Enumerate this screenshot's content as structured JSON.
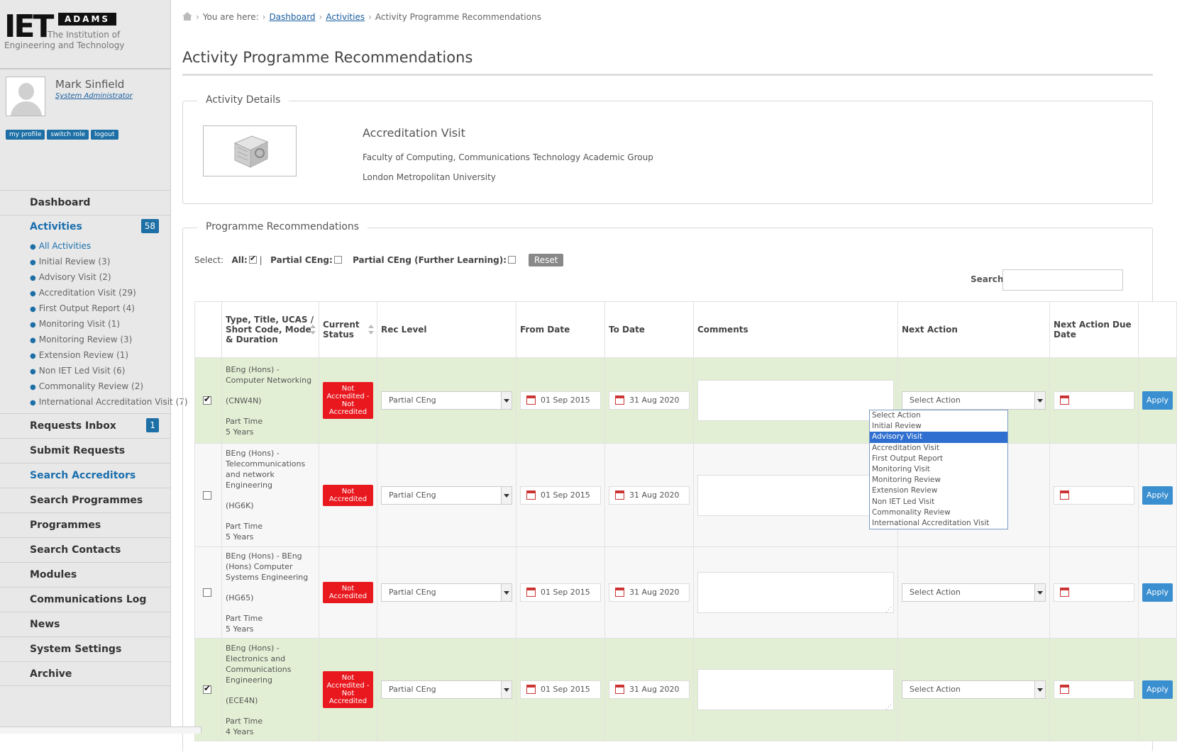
{
  "brand": {
    "logo_text": "IET",
    "product": "ADAMS",
    "institution_line1": "The Institution of",
    "institution_line2": "Engineering and Technology"
  },
  "user": {
    "name": "Mark Sinfield",
    "role": "System Administrator",
    "buttons": [
      "my profile",
      "switch role",
      "logout"
    ]
  },
  "nav": {
    "dashboard": "Dashboard",
    "activities": "Activities",
    "activities_count": "58",
    "activity_types": [
      "All Activities",
      "Initial Review (3)",
      "Advisory Visit (2)",
      "Accreditation Visit (29)",
      "First Output Report (4)",
      "Monitoring Visit (1)",
      "Monitoring Review (3)",
      "Extension Review (1)",
      "Non IET Led Visit (6)",
      "Commonality Review (2)",
      "International Accreditation Visit (7)"
    ],
    "requests_inbox": "Requests Inbox",
    "requests_inbox_count": "1",
    "items": [
      "Submit Requests",
      "Search Accreditors",
      "Search Programmes",
      "Programmes",
      "Search Contacts",
      "Modules",
      "Communications Log",
      "News",
      "System Settings",
      "Archive"
    ]
  },
  "breadcrumb": {
    "prefix": "You are here:",
    "dashboard": "Dashboard",
    "activities": "Activities",
    "current": "Activity Programme Recommendations"
  },
  "page_title": "Activity Programme Recommendations",
  "activity_details": {
    "legend": "Activity Details",
    "title": "Accreditation Visit",
    "faculty": "Faculty of Computing, Communications Technology Academic Group",
    "university": "London Metropolitan University"
  },
  "programme_recs": {
    "legend": "Programme Recommendations",
    "select_label": "Select:",
    "all_label": "All:",
    "partial_label": "Partial CEng:",
    "partial_fl_label": "Partial CEng (Further Learning):",
    "reset": "Reset",
    "search_label": "Search:",
    "search_value": "",
    "columns": {
      "type": "Type, Title, UCAS / Short Code, Mode & Duration",
      "status": "Current Status",
      "rec_level": "Rec Level",
      "from_date": "From Date",
      "to_date": "To Date",
      "comments": "Comments",
      "next_action": "Next Action",
      "due_date": "Next Action Due Date"
    },
    "rows": [
      {
        "checked": true,
        "title": "BEng (Hons) - Computer Networking",
        "code": "(CNW4N)",
        "mode": "Part Time",
        "duration": "5 Years",
        "status": "Not Accredited - Not Accredited",
        "rec_level": "Partial CEng",
        "from": "01 Sep 2015",
        "to": "31 Aug 2020",
        "next_action": "Select Action",
        "apply": "Apply"
      },
      {
        "checked": false,
        "title": "BEng (Hons) - Telecommunications and network Engineering",
        "code": "(HG6K)",
        "mode": "Part Time",
        "duration": "5 Years",
        "status": "Not Accredited",
        "rec_level": "Partial CEng",
        "from": "01 Sep 2015",
        "to": "31 Aug 2020",
        "next_action": "Select Action",
        "apply": "Apply"
      },
      {
        "checked": false,
        "title": "BEng (Hons) - BEng (Hons) Computer Systems Engineering",
        "code": "(HG65)",
        "mode": "Part Time",
        "duration": "5 Years",
        "status": "Not Accredited",
        "rec_level": "Partial CEng",
        "from": "01 Sep 2015",
        "to": "31 Aug 2020",
        "next_action": "Select Action",
        "apply": "Apply"
      },
      {
        "checked": true,
        "title": "BEng (Hons) - Electronics and Communications Engineering",
        "code": "(ECE4N)",
        "mode": "Part Time",
        "duration": "4 Years",
        "status": "Not Accredited - Not Accredited",
        "rec_level": "Partial CEng",
        "from": "01 Sep 2015",
        "to": "31 Aug 2020",
        "next_action": "Select Action",
        "apply": "Apply"
      }
    ],
    "next_action_options": [
      "Select Action",
      "Initial Review",
      "Advisory Visit",
      "Accreditation Visit",
      "First Output Report",
      "Monitoring Visit",
      "Monitoring Review",
      "Extension Review",
      "Non IET Led Visit",
      "Commonality Review",
      "International Accreditation Visit"
    ],
    "highlighted_option": "Advisory Visit"
  },
  "colors": {
    "accent_blue": "#1d6fa5",
    "status_red": "#e8181e",
    "row_green": "#e2efd4",
    "apply_blue": "#3a8fd0"
  }
}
